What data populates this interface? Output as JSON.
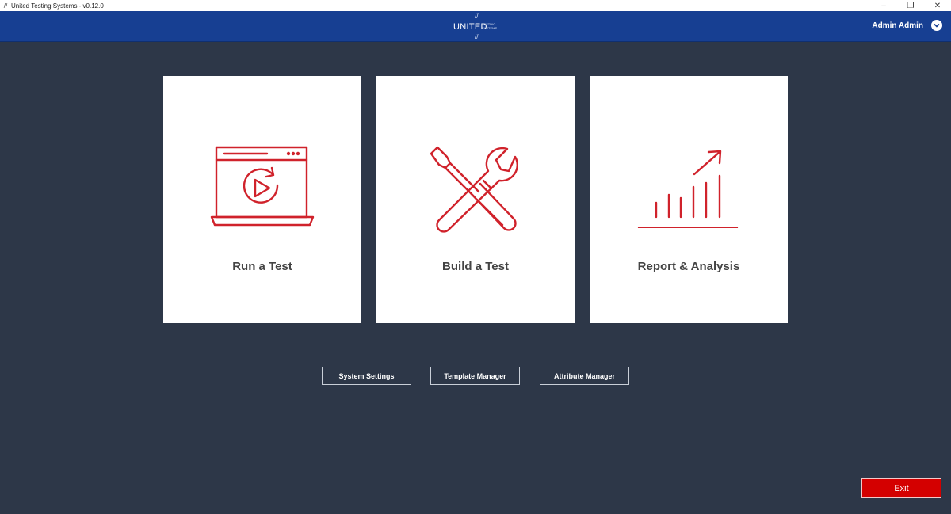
{
  "window": {
    "title": "United Testing Systems - v0.12.0",
    "app_icon": "slash-logo-icon",
    "controls": [
      "minimize-icon",
      "restore-icon",
      "close-icon"
    ]
  },
  "header": {
    "logo_text": "UNITED",
    "logo_subtext_1": "TESTING",
    "logo_subtext_2": "SYSTEMS",
    "logo_slash": "//",
    "user_name": "Admin Admin",
    "user_menu_icon": "chevron-down-icon"
  },
  "cards": [
    {
      "label": "Run a Test",
      "icon": "laptop-play-icon"
    },
    {
      "label": "Build a Test",
      "icon": "tools-icon"
    },
    {
      "label": "Report & Analysis",
      "icon": "bar-chart-growth-icon"
    }
  ],
  "buttons": {
    "system_settings": "System Settings",
    "template_manager": "Template Manager",
    "attribute_manager": "Attribute Manager",
    "exit": "Exit"
  },
  "colors": {
    "header_bg": "#173f92",
    "page_bg": "#2d3748",
    "icon_red": "#d0222b",
    "exit_red": "#d40000"
  }
}
